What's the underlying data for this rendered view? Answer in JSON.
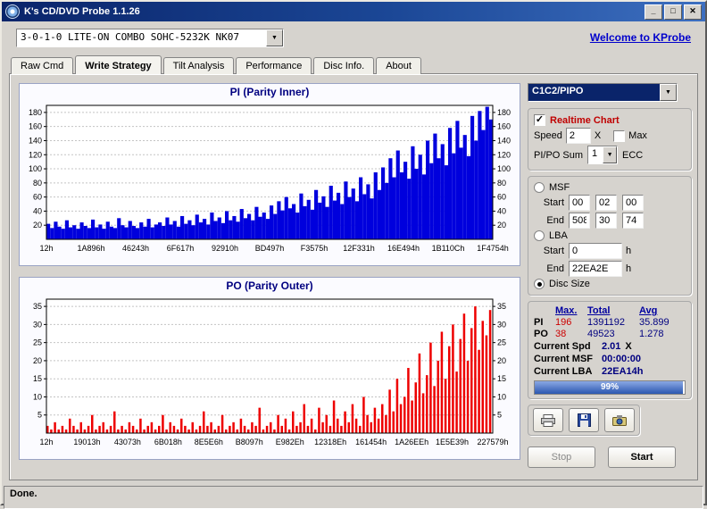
{
  "window": {
    "title": "K's CD/DVD Probe 1.1.26"
  },
  "titlebar_icons": {
    "minimize": "_",
    "maximize": "□",
    "close": "✕"
  },
  "icons": {
    "dropdown": "▼",
    "check": "✓"
  },
  "drive": {
    "selected": "3-0-1-0 LITE-ON COMBO SOHC-5232K NK07"
  },
  "header": {
    "welcome_link": "Welcome to KProbe"
  },
  "tabs": {
    "items": [
      "Raw Cmd",
      "Write Strategy",
      "Tilt Analysis",
      "Performance",
      "Disc Info.",
      "About"
    ],
    "active_index": 1
  },
  "controls": {
    "mode_combo": {
      "value": "C1C2/PIPO"
    },
    "realtime": {
      "label": "Realtime Chart",
      "checked": true
    },
    "speed": {
      "label": "Speed",
      "value": "2",
      "x_label": "X",
      "max_label": "Max",
      "max_checked": false
    },
    "sum": {
      "label": "PI/PO Sum",
      "value": "1",
      "ecc_label": "ECC"
    },
    "msf": {
      "label": "MSF",
      "start_label": "Start",
      "end_label": "End",
      "start": [
        "00",
        "02",
        "00"
      ],
      "end": [
        "508",
        "30",
        "74"
      ]
    },
    "lba": {
      "label": "LBA",
      "start_label": "Start",
      "end_label": "End",
      "start": "0",
      "end": "22EA2E",
      "unit": "h"
    },
    "disc_size": {
      "label": "Disc Size",
      "selected": true
    },
    "stats": {
      "headers": [
        "Max.",
        "Total",
        "Avg"
      ],
      "rows": [
        {
          "label": "PI",
          "max": "196",
          "total": "1391192",
          "avg": "35.899"
        },
        {
          "label": "PO",
          "max": "38",
          "total": "49523",
          "avg": "1.278"
        }
      ]
    },
    "current_spd": {
      "label": "Current Spd",
      "value": "2.01",
      "suffix": "X"
    },
    "current_msf": {
      "label": "Current MSF",
      "value": "00:00:00"
    },
    "current_lba": {
      "label": "Current LBA",
      "value": "22EA14h"
    },
    "progress": {
      "percent": 99,
      "label": "99%"
    },
    "stop_label": "Stop",
    "start_label": "Start"
  },
  "statusbar": {
    "text": "Done."
  },
  "chart_data": [
    {
      "type": "bar",
      "title": "PI (Parity Inner)",
      "color": "#0000dd",
      "ylim": [
        0,
        190
      ],
      "yticks": [
        20,
        40,
        60,
        80,
        100,
        120,
        140,
        160,
        180
      ],
      "x_labels": [
        "12h",
        "1A896h",
        "46243h",
        "6F617h",
        "92910h",
        "BD497h",
        "F3575h",
        "12F331h",
        "16E494h",
        "1B110Ch",
        "1F4754h"
      ],
      "values": [
        22,
        16,
        25,
        18,
        15,
        27,
        17,
        20,
        15,
        24,
        19,
        16,
        28,
        17,
        21,
        15,
        25,
        18,
        16,
        30,
        20,
        17,
        26,
        19,
        16,
        24,
        18,
        29,
        17,
        21,
        24,
        19,
        31,
        21,
        26,
        18,
        33,
        22,
        27,
        20,
        35,
        24,
        29,
        21,
        38,
        26,
        31,
        23,
        40,
        27,
        33,
        25,
        43,
        30,
        36,
        27,
        46,
        32,
        38,
        29,
        48,
        36,
        54,
        41,
        60,
        44,
        50,
        38,
        65,
        47,
        56,
        42,
        70,
        52,
        61,
        46,
        76,
        55,
        66,
        50,
        82,
        60,
        72,
        54,
        88,
        64,
        78,
        58,
        95,
        70,
        102,
        80,
        115,
        88,
        126,
        95,
        110,
        86,
        132,
        100,
        120,
        92,
        140,
        108,
        150,
        115,
        135,
        105,
        158,
        122,
        168,
        130,
        148,
        118,
        175,
        140,
        182,
        155,
        188,
        170
      ]
    },
    {
      "type": "bar",
      "title": "PO (Parity Outer)",
      "color": "#ee0000",
      "ylim": [
        0,
        37
      ],
      "yticks": [
        5,
        10,
        15,
        20,
        25,
        30,
        35
      ],
      "x_labels": [
        "12h",
        "19013h",
        "43073h",
        "6B018h",
        "8E5E6h",
        "B8097h",
        "E982Eh",
        "12318Eh",
        "161454h",
        "1A26EEh",
        "1E5E39h",
        "227579h"
      ],
      "values": [
        2,
        1,
        3,
        1,
        2,
        1,
        4,
        2,
        1,
        3,
        1,
        2,
        5,
        1,
        2,
        3,
        1,
        2,
        6,
        1,
        2,
        1,
        3,
        2,
        1,
        4,
        1,
        2,
        3,
        1,
        2,
        5,
        1,
        3,
        2,
        1,
        4,
        2,
        1,
        3,
        1,
        2,
        6,
        2,
        3,
        1,
        2,
        5,
        1,
        2,
        3,
        1,
        4,
        2,
        1,
        3,
        2,
        7,
        1,
        2,
        3,
        1,
        5,
        2,
        4,
        1,
        6,
        2,
        3,
        8,
        2,
        4,
        1,
        7,
        3,
        5,
        2,
        9,
        4,
        2,
        6,
        3,
        8,
        4,
        2,
        10,
        5,
        3,
        7,
        4,
        8,
        5,
        12,
        6,
        15,
        8,
        10,
        18,
        9,
        14,
        22,
        11,
        16,
        25,
        13,
        20,
        28,
        15,
        24,
        30,
        17,
        26,
        33,
        20,
        29,
        35,
        23,
        31,
        27,
        34
      ]
    }
  ]
}
